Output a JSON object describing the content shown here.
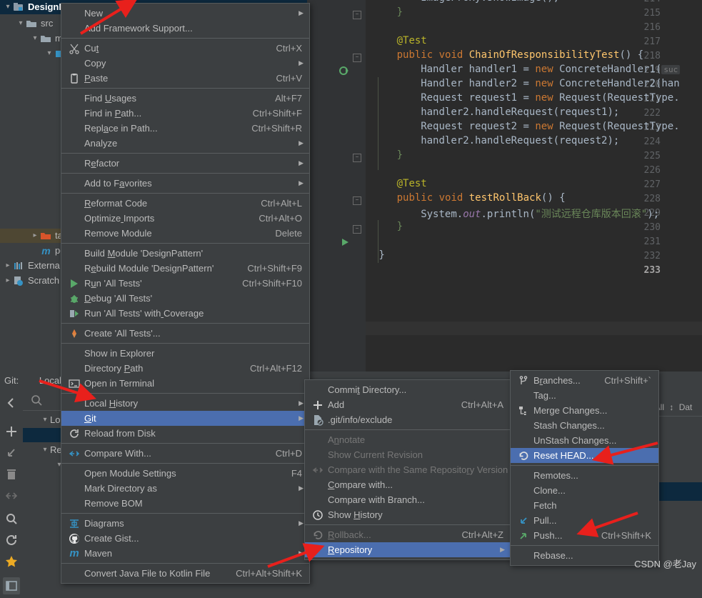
{
  "project_tree": {
    "items": [
      {
        "label": "DesignPattern",
        "indent": 0,
        "icon": "module-icon",
        "selected": true,
        "expanded": true
      },
      {
        "label": "src",
        "indent": 1,
        "icon": "folder-icon",
        "expanded": true
      },
      {
        "label": "m",
        "indent": 2,
        "icon": "folder-icon",
        "expanded": true
      },
      {
        "label": "",
        "indent": 3,
        "icon": "source-folder-icon",
        "expanded": true
      },
      {
        "label": "",
        "indent": 4,
        "icon": "package-icon",
        "expanded": true
      },
      {
        "label": "targ",
        "indent": 2,
        "icon": "target-folder-icon",
        "expanded": false,
        "highlighted": true
      },
      {
        "label": "pom",
        "indent": 3,
        "icon": "maven-icon"
      },
      {
        "label": "Externa",
        "indent": 0,
        "icon": "external-libraries-icon",
        "expanded": false
      },
      {
        "label": "Scratch",
        "indent": 0,
        "icon": "scratches-icon",
        "expanded": false
      }
    ]
  },
  "editor": {
    "lines": [
      {
        "num": "214",
        "indent": 8,
        "tokens": [
          {
            "t": "ImageProxy.showImage();",
            "c": "cls"
          }
        ]
      },
      {
        "num": "215",
        "indent": 4,
        "tokens": [
          {
            "t": "}",
            "c": "st"
          }
        ],
        "fold": true
      },
      {
        "num": "216",
        "indent": 0,
        "tokens": []
      },
      {
        "num": "217",
        "indent": 4,
        "tokens": [
          {
            "t": "@Test",
            "c": "an"
          }
        ]
      },
      {
        "num": "218",
        "indent": 4,
        "tokens": [
          {
            "t": "public void ",
            "c": "k"
          },
          {
            "t": "ChainOfResponsibilityTest",
            "c": "fn"
          },
          {
            "t": "() {",
            "c": "br"
          }
        ],
        "fold": true,
        "gutter": "run-test-icon-green-ring"
      },
      {
        "num": "219",
        "indent": 8,
        "tokens": [
          {
            "t": "Handler handler1 = ",
            "c": "cls"
          },
          {
            "t": "new ",
            "c": "k"
          },
          {
            "t": "ConcreteHandler1",
            "c": "cls"
          },
          {
            "t": "(",
            "c": "brp"
          },
          {
            "t": " suc",
            "c": "hint"
          }
        ]
      },
      {
        "num": "220",
        "indent": 8,
        "tokens": [
          {
            "t": "Handler handler2 = ",
            "c": "cls"
          },
          {
            "t": "new ",
            "c": "k"
          },
          {
            "t": "ConcreteHandler2",
            "c": "cls"
          },
          {
            "t": "(han",
            "c": "brp"
          }
        ]
      },
      {
        "num": "221",
        "indent": 8,
        "tokens": [
          {
            "t": "Request request1 = ",
            "c": "cls"
          },
          {
            "t": "new ",
            "c": "k"
          },
          {
            "t": "Request",
            "c": "cls"
          },
          {
            "t": "(",
            "c": "brp"
          },
          {
            "t": "RequestType.",
            "c": "cls"
          }
        ]
      },
      {
        "num": "222",
        "indent": 8,
        "tokens": [
          {
            "t": "handler2.handleRequest",
            "c": "cls"
          },
          {
            "t": "(request1);",
            "c": "brp"
          }
        ]
      },
      {
        "num": "223",
        "indent": 8,
        "tokens": [
          {
            "t": "Request request2 = ",
            "c": "cls"
          },
          {
            "t": "new ",
            "c": "k"
          },
          {
            "t": "Request",
            "c": "cls"
          },
          {
            "t": "(",
            "c": "brp"
          },
          {
            "t": "RequestType.",
            "c": "cls"
          }
        ]
      },
      {
        "num": "224",
        "indent": 8,
        "tokens": [
          {
            "t": "handler2.handleRequest",
            "c": "cls"
          },
          {
            "t": "(request2);",
            "c": "brp"
          }
        ]
      },
      {
        "num": "225",
        "indent": 4,
        "tokens": [
          {
            "t": "}",
            "c": "st"
          }
        ],
        "fold": true
      },
      {
        "num": "226",
        "indent": 0,
        "tokens": []
      },
      {
        "num": "227",
        "indent": 4,
        "tokens": [
          {
            "t": "@Test",
            "c": "an"
          }
        ]
      },
      {
        "num": "228",
        "indent": 4,
        "tokens": [
          {
            "t": "public void ",
            "c": "k"
          },
          {
            "t": "testRollBack",
            "c": "fn"
          },
          {
            "t": "() {",
            "c": "br"
          }
        ],
        "fold": true,
        "gutter": "run-test-icon-green-triangle"
      },
      {
        "num": "229",
        "indent": 8,
        "tokens": [
          {
            "t": "System.",
            "c": "cls"
          },
          {
            "t": "out",
            "c": "fld"
          },
          {
            "t": ".println",
            "c": "cls"
          },
          {
            "t": "(",
            "c": "brp"
          },
          {
            "t": "\"测试远程仓库版本回滚\"",
            "c": "st"
          },
          {
            "t": ");",
            "c": "brp"
          }
        ]
      },
      {
        "num": "230",
        "indent": 4,
        "tokens": [
          {
            "t": "}",
            "c": "st"
          }
        ],
        "fold": true
      },
      {
        "num": "231",
        "indent": 0,
        "tokens": []
      },
      {
        "num": "232",
        "indent": 1,
        "tokens": [
          {
            "t": "}",
            "c": "br"
          }
        ]
      },
      {
        "num": "233",
        "indent": 0,
        "tokens": [],
        "current": true
      }
    ]
  },
  "git_panel": {
    "label": "Git:",
    "tab": "Local C",
    "search_placeholder": "",
    "groups": [
      {
        "label": "Local",
        "expanded": true
      },
      {
        "label": "",
        "tag": true,
        "selected": true
      },
      {
        "label": "Remo",
        "expanded": true
      },
      {
        "label": "",
        "indent": true
      }
    ],
    "toolbar_icons": [
      "back-icon",
      "add-icon",
      "checkout-icon",
      "delete-icon",
      "collapse-icon",
      "search-icon",
      "refresh-icon",
      "favorite-star-icon",
      "show-branches-icon"
    ]
  },
  "log_panel": {
    "filter_text": "er: All",
    "date_label": "Dat"
  },
  "context_menu_project": {
    "title": "project-context-menu",
    "items": [
      {
        "label": "New",
        "icon": "",
        "accel": "",
        "submenu": true
      },
      {
        "label": "Add Framework Support...",
        "icon": "",
        "accel": ""
      },
      {
        "sep": true
      },
      {
        "label": "Cut",
        "icon": "scissors-icon",
        "accel": "Ctrl+X",
        "mn": 2
      },
      {
        "label": "Copy",
        "icon": "",
        "accel": "",
        "submenu": true
      },
      {
        "label": "Paste",
        "icon": "clipboard-icon",
        "accel": "Ctrl+V",
        "mn": 0
      },
      {
        "sep": true
      },
      {
        "label": "Find Usages",
        "icon": "",
        "accel": "Alt+F7",
        "mn": 5
      },
      {
        "label": "Find in Path...",
        "icon": "",
        "accel": "Ctrl+Shift+F",
        "mn": 8
      },
      {
        "label": "Replace in Path...",
        "icon": "",
        "accel": "Ctrl+Shift+R",
        "mn": 4
      },
      {
        "label": "Analyze",
        "icon": "",
        "accel": "",
        "submenu": true
      },
      {
        "sep": true
      },
      {
        "label": "Refactor",
        "icon": "",
        "accel": "",
        "submenu": true,
        "mn": 1
      },
      {
        "sep": true
      },
      {
        "label": "Add to Favorites",
        "icon": "",
        "accel": "",
        "submenu": true,
        "mn": 8
      },
      {
        "sep": true
      },
      {
        "label": "Reformat Code",
        "icon": "",
        "accel": "Ctrl+Alt+L",
        "mn": 0
      },
      {
        "label": "Optimize Imports",
        "icon": "",
        "accel": "Ctrl+Alt+O",
        "mn": 8
      },
      {
        "label": "Remove Module",
        "icon": "",
        "accel": "Delete"
      },
      {
        "sep": true
      },
      {
        "label": "Build Module 'DesignPattern'",
        "icon": "",
        "accel": "",
        "mn": 6
      },
      {
        "label": "Rebuild Module 'DesignPattern'",
        "icon": "",
        "accel": "Ctrl+Shift+F9",
        "mn": 1
      },
      {
        "label": "Run 'All Tests'",
        "icon": "run-green-triangle-icon",
        "accel": "Ctrl+Shift+F10",
        "mn": 1
      },
      {
        "label": "Debug 'All Tests'",
        "icon": "debug-bug-icon",
        "accel": "",
        "mn": 0
      },
      {
        "label": "Run 'All Tests' with Coverage",
        "icon": "coverage-icon",
        "accel": "",
        "mn": 20
      },
      {
        "sep": true
      },
      {
        "label": "Create 'All Tests'...",
        "icon": "create-config-icon",
        "accel": ""
      },
      {
        "sep": true
      },
      {
        "label": "Show in Explorer",
        "icon": "",
        "accel": ""
      },
      {
        "label": "Directory Path",
        "icon": "",
        "accel": "Ctrl+Alt+F12",
        "mn": 10
      },
      {
        "label": "Open in Terminal",
        "icon": "terminal-icon",
        "accel": ""
      },
      {
        "sep": true
      },
      {
        "label": "Local History",
        "icon": "",
        "accel": "",
        "submenu": true,
        "mn": 6
      },
      {
        "label": "Git",
        "icon": "",
        "accel": "",
        "submenu": true,
        "highlighted": true,
        "mn": 0
      },
      {
        "label": "Reload from Disk",
        "icon": "reload-icon",
        "accel": ""
      },
      {
        "sep": true
      },
      {
        "label": "Compare With...",
        "icon": "compare-icon",
        "accel": "Ctrl+D"
      },
      {
        "sep": true
      },
      {
        "label": "Open Module Settings",
        "icon": "",
        "accel": "F4"
      },
      {
        "label": "Mark Directory as",
        "icon": "",
        "accel": "",
        "submenu": true
      },
      {
        "label": "Remove BOM",
        "icon": "",
        "accel": ""
      },
      {
        "sep": true
      },
      {
        "label": "Diagrams",
        "icon": "diagram-icon",
        "accel": "",
        "submenu": true
      },
      {
        "label": "Create Gist...",
        "icon": "github-icon",
        "accel": ""
      },
      {
        "label": "Maven",
        "icon": "maven-m-icon",
        "accel": "",
        "submenu": true
      },
      {
        "sep": true
      },
      {
        "label": "Convert Java File to Kotlin File",
        "icon": "",
        "accel": "Ctrl+Alt+Shift+K"
      }
    ]
  },
  "context_menu_git": {
    "title": "git-submenu",
    "items": [
      {
        "label": "Commit Directory...",
        "icon": "",
        "accel": "",
        "mn": 5
      },
      {
        "label": "Add",
        "icon": "plus-icon",
        "accel": "Ctrl+Alt+A"
      },
      {
        "label": ".git/info/exclude",
        "icon": "git-exclude-icon",
        "accel": ""
      },
      {
        "sep": true
      },
      {
        "label": "Annotate",
        "icon": "",
        "accel": "",
        "disabled": true,
        "mn": 1
      },
      {
        "label": "Show Current Revision",
        "icon": "",
        "accel": "",
        "disabled": true
      },
      {
        "label": "Compare with the Same Repository Version",
        "icon": "compare-disabled-icon",
        "accel": "",
        "disabled": true,
        "mn": 30
      },
      {
        "label": "Compare with...",
        "icon": "",
        "accel": "",
        "mn": 0
      },
      {
        "label": "Compare with Branch...",
        "icon": "",
        "accel": ""
      },
      {
        "label": "Show History",
        "icon": "history-clock-icon",
        "accel": "",
        "mn": 5
      },
      {
        "sep": true
      },
      {
        "label": "Rollback...",
        "icon": "rollback-icon",
        "accel": "Ctrl+Alt+Z",
        "disabled": true,
        "mn": 0
      },
      {
        "label": "Repository",
        "icon": "",
        "accel": "",
        "submenu": true,
        "highlighted": true,
        "mn": 0
      }
    ]
  },
  "context_menu_repository": {
    "title": "repository-submenu",
    "items": [
      {
        "label": "Branches...",
        "icon": "branch-icon",
        "accel": "Ctrl+Shift+`",
        "mn": 1
      },
      {
        "label": "Tag...",
        "icon": "",
        "accel": ""
      },
      {
        "label": "Merge Changes...",
        "icon": "merge-icon",
        "accel": ""
      },
      {
        "label": "Stash Changes...",
        "icon": "",
        "accel": ""
      },
      {
        "label": "UnStash Changes...",
        "icon": "",
        "accel": ""
      },
      {
        "label": "Reset HEAD...",
        "icon": "reset-head-icon",
        "accel": "",
        "highlighted": true
      },
      {
        "sep": true
      },
      {
        "label": "Remotes...",
        "icon": "",
        "accel": ""
      },
      {
        "label": "Clone...",
        "icon": "",
        "accel": ""
      },
      {
        "label": "Fetch",
        "icon": "",
        "accel": ""
      },
      {
        "label": "Pull...",
        "icon": "pull-arrow-icon",
        "accel": ""
      },
      {
        "label": "Push...",
        "icon": "push-arrow-icon",
        "accel": "Ctrl+Shift+K"
      },
      {
        "sep": true
      },
      {
        "label": "Rebase...",
        "icon": "",
        "accel": ""
      }
    ]
  },
  "watermark": "CSDN @老Jay",
  "colors": {
    "menu_bg": "#3c3f41",
    "menu_border": "#565a5c",
    "highlight": "#4b6eaf",
    "editor_bg": "#2b2b2b",
    "gutter_bg": "#313335",
    "selection": "#0d293e",
    "annotation_arrow": "#e8201c"
  }
}
